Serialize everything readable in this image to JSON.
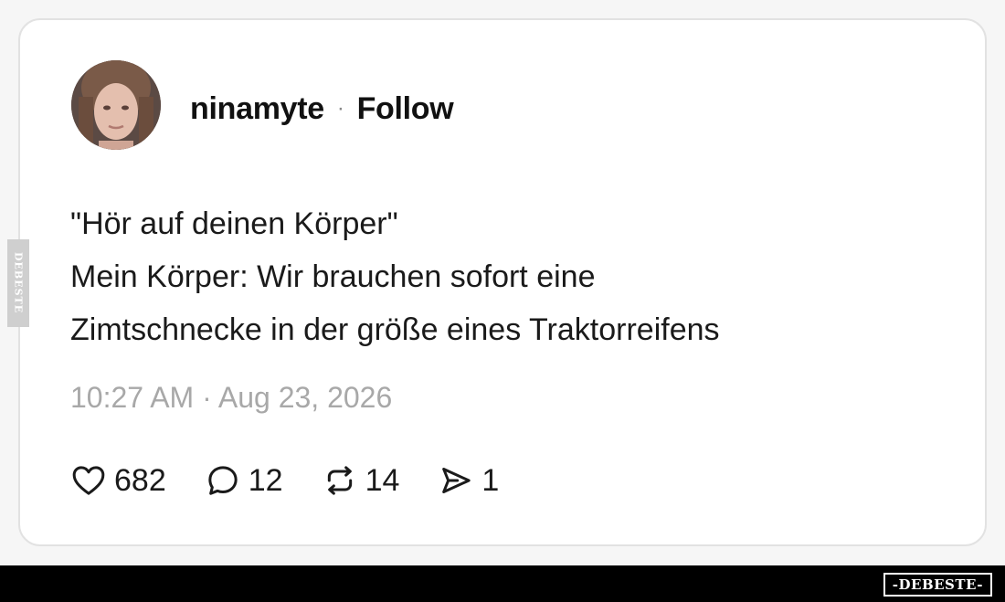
{
  "post": {
    "username": "ninamyte",
    "separator": "·",
    "follow_label": "Follow",
    "text_lines": [
      "\"Hör auf deinen Körper\"",
      "Mein Körper: Wir brauchen sofort eine",
      "Zimtschnecke in der größe eines Traktorreifens"
    ],
    "timestamp": "10:27 AM · Aug 23, 2026",
    "actions": {
      "likes": "682",
      "replies": "12",
      "reposts": "14",
      "shares": "1"
    }
  },
  "icons": {
    "like": "heart-icon",
    "reply": "speech-bubble-icon",
    "repost": "repost-arrows-icon",
    "share": "send-icon"
  },
  "watermark": {
    "side": "DEBESTE",
    "logo": "-DEBESTE-"
  }
}
